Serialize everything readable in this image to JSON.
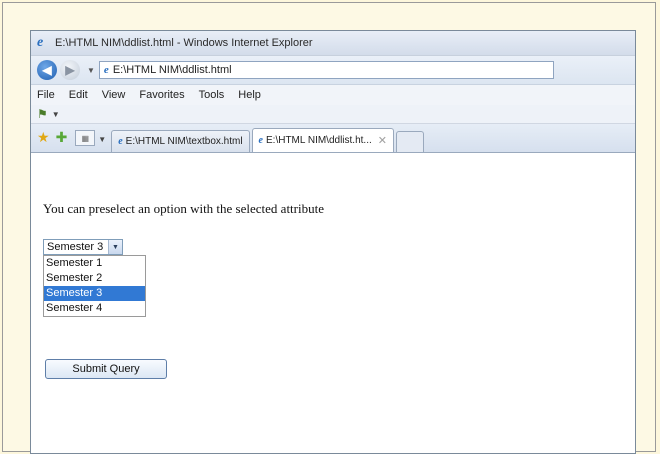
{
  "window": {
    "title": "E:\\HTML NIM\\ddlist.html - Windows Internet Explorer"
  },
  "address": {
    "url": "E:\\HTML NIM\\ddlist.html"
  },
  "menu": {
    "items": [
      "File",
      "Edit",
      "View",
      "Favorites",
      "Tools",
      "Help"
    ]
  },
  "tabs": [
    {
      "label": "E:\\HTML NIM\\textbox.html"
    },
    {
      "label": "E:\\HTML NIM\\ddlist.ht..."
    }
  ],
  "page": {
    "intro_text": "You can preselect an option with the selected attribute",
    "select": {
      "value": "Semester 3",
      "options": [
        "Semester 1",
        "Semester 2",
        "Semester 3",
        "Semester 4"
      ],
      "highlighted_index": 2
    },
    "submit_label": "Submit Query"
  },
  "colors": {
    "highlight": "#3179d4",
    "background": "#fdf7dc"
  }
}
